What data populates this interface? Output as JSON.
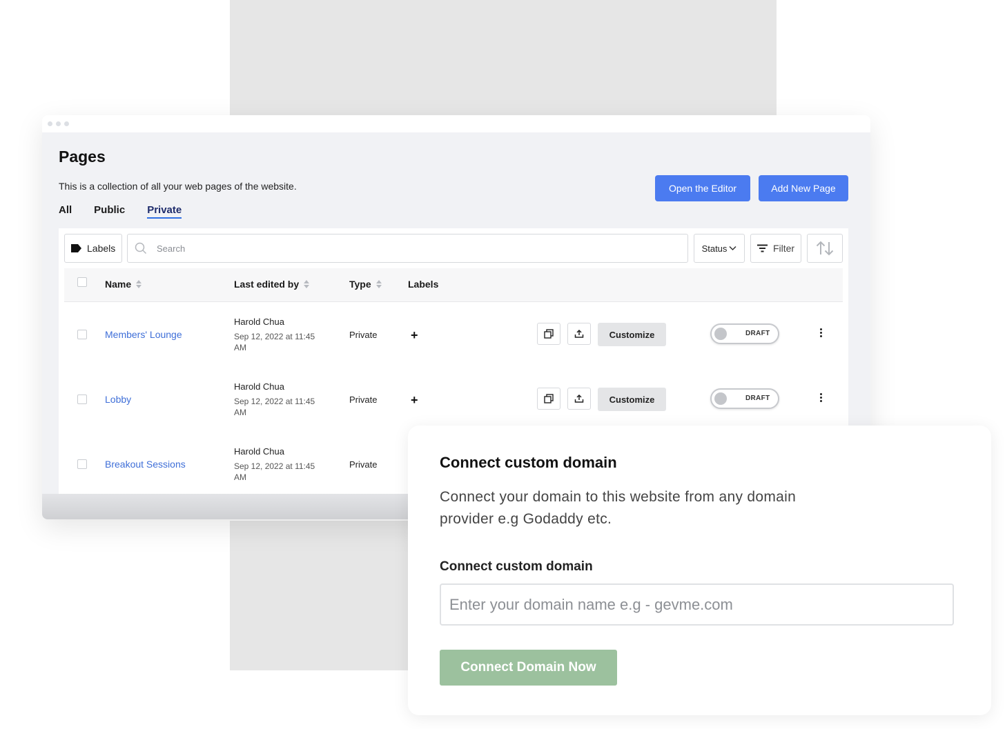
{
  "page": {
    "title": "Pages",
    "description": "This is a collection of all your web pages of the website.",
    "tabs": [
      {
        "label": "All",
        "active": false
      },
      {
        "label": "Public",
        "active": false
      },
      {
        "label": "Private",
        "active": true
      }
    ],
    "buttons": {
      "open_editor": "Open the Editor",
      "add_new_page": "Add New Page"
    }
  },
  "toolbar": {
    "labels_button": "Labels",
    "search_placeholder": "Search",
    "status_dropdown": "Status",
    "filter_button": "Filter"
  },
  "table": {
    "columns": [
      "Name",
      "Last edited by",
      "Type",
      "Labels"
    ],
    "rows": [
      {
        "name": "Members' Lounge",
        "editor": "Harold Chua",
        "edited_at": "Sep 12, 2022 at 11:45 AM",
        "type": "Private",
        "add_label": "+",
        "customize": "Customize",
        "status": "DRAFT"
      },
      {
        "name": "Lobby",
        "editor": "Harold Chua",
        "edited_at": "Sep 12, 2022 at 11:45 AM",
        "type": "Private",
        "add_label": "+",
        "customize": "Customize",
        "status": "DRAFT"
      },
      {
        "name": "Breakout Sessions",
        "editor": "Harold Chua",
        "edited_at": "Sep 12, 2022 at 11:45 AM",
        "type": "Private"
      }
    ]
  },
  "domain_card": {
    "title": "Connect custom domain",
    "description": "Connect your domain to this website from any domain provider e.g Godaddy etc.",
    "field_label": "Connect custom domain",
    "input_placeholder": "Enter your domain name e.g - gevme.com",
    "button_label": "Connect Domain Now"
  },
  "colors": {
    "primary_button": "#4b7bf0",
    "link": "#3f6fd8",
    "connect_button": "#9cc19e",
    "active_tab_underline": "#2f6fe4"
  }
}
